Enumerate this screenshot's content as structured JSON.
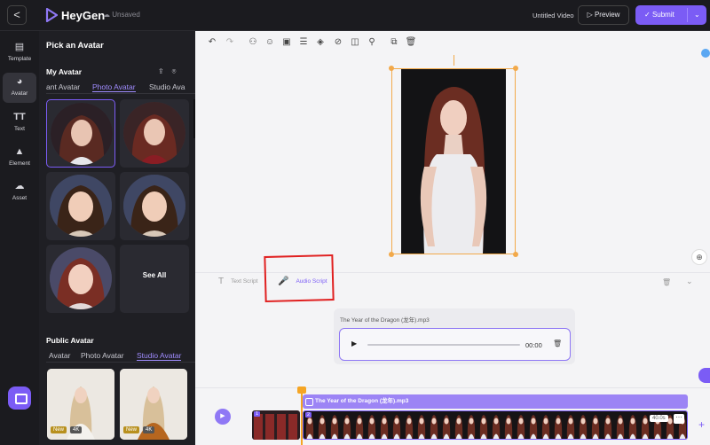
{
  "header": {
    "back_label": "<",
    "brand": "HeyGen",
    "save_status": "Unsaved",
    "video_title": "Untitled Video",
    "preview_label": "Preview",
    "submit_label": "Submit",
    "accent_color": "#7b5cf5"
  },
  "rail": {
    "items": [
      {
        "label": "Template",
        "icon": "template-icon"
      },
      {
        "label": "Avatar",
        "icon": "avatar-icon",
        "active": true
      },
      {
        "label": "Text",
        "icon": "text-icon"
      },
      {
        "label": "Element",
        "icon": "element-icon"
      },
      {
        "label": "Asset",
        "icon": "asset-icon"
      }
    ],
    "text_glyph": "TT"
  },
  "panel": {
    "title": "Pick an Avatar",
    "my_avatar": {
      "title": "My Avatar",
      "tabs": [
        "ant Avatar",
        "Photo Avatar",
        "Studio Ava"
      ],
      "active_tab": "Photo Avatar",
      "see_all": "See All"
    },
    "public_avatar": {
      "title": "Public Avatar",
      "tabs": [
        "Avatar",
        "Photo Avatar",
        "Studio Avatar"
      ],
      "active_tab": "Studio Avatar",
      "badges": {
        "new": "New",
        "quality": "4K"
      }
    }
  },
  "script": {
    "text_tab": "Text Script",
    "audio_tab": "Audio Script",
    "audio_file": "The Year of the Dragon (龙年).mp3",
    "time": "00:00"
  },
  "timeline": {
    "audio_track": "The Year of the Dragon (龙年).mp3",
    "scenes": [
      "1",
      "2"
    ],
    "duration": "40.0s"
  }
}
